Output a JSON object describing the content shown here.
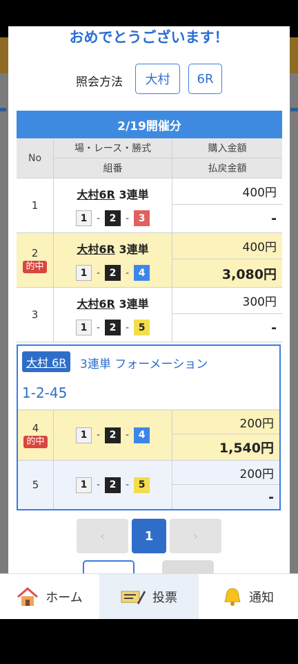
{
  "modal": {
    "congrats_text": "おめでとうございます！"
  },
  "inquiry": {
    "label": "照会方法",
    "venue": "大村",
    "race": "6R"
  },
  "date_header": "2/19開催分",
  "table": {
    "headers": {
      "no": "No",
      "race_col": "場・レース・勝式",
      "combo_col": "組番",
      "bet_col": "購入金額",
      "payout_col": "払戻金額"
    },
    "rows": [
      {
        "no": "1",
        "venue_race": "大村6R",
        "type": "3連単",
        "combo": [
          "1",
          "2",
          "3"
        ],
        "bet": "400円",
        "payout": "-",
        "hit": ""
      },
      {
        "no": "2",
        "venue_race": "大村6R",
        "type": "3連単",
        "combo": [
          "1",
          "2",
          "4"
        ],
        "bet": "400円",
        "payout": "3,080円",
        "hit": "的中"
      },
      {
        "no": "3",
        "venue_race": "大村6R",
        "type": "3連単",
        "combo": [
          "1",
          "2",
          "5"
        ],
        "bet": "300円",
        "payout": "-",
        "hit": ""
      }
    ],
    "dash": "-"
  },
  "formation": {
    "venue_race": "大村 6R",
    "title": "3連単 フォーメーション",
    "combo_text": "1-2-45",
    "rows": [
      {
        "no": "4",
        "combo": [
          "1",
          "2",
          "4"
        ],
        "bet": "200円",
        "payout": "1,540円",
        "hit": "的中"
      },
      {
        "no": "5",
        "combo": [
          "1",
          "2",
          "5"
        ],
        "bet": "200円",
        "payout": "-",
        "hit": ""
      }
    ]
  },
  "pagination": {
    "prev": "‹",
    "current": "1",
    "next": "›"
  },
  "tabs": [
    {
      "label": "ホーム",
      "icon": "home-icon"
    },
    {
      "label": "投票",
      "icon": "ticket-icon"
    },
    {
      "label": "通知",
      "icon": "bell-icon"
    }
  ],
  "colors": {
    "accent": "#3d8ae0",
    "hit_badge": "#d8473f",
    "hit_row": "#fbf2bc"
  }
}
